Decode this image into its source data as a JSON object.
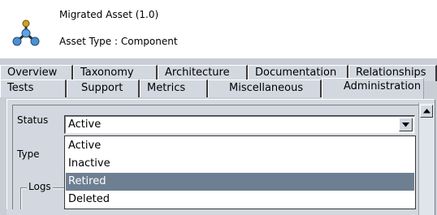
{
  "header": {
    "title": "Migrated Asset (1.0)",
    "asset_type": "Asset Type : Component",
    "icon": "component-molecule-icon"
  },
  "tabs": {
    "back_row": [
      {
        "label": "Overview"
      },
      {
        "label": "Taxonomy"
      },
      {
        "label": "Architecture"
      },
      {
        "label": "Documentation"
      },
      {
        "label": "Relationships"
      }
    ],
    "front_row": [
      {
        "label": "Tests"
      },
      {
        "label": "Support"
      },
      {
        "label": "Metrics"
      },
      {
        "label": "Miscellaneous"
      },
      {
        "label": "Administration",
        "active": true
      }
    ]
  },
  "form": {
    "status_label": "Status",
    "type_label": "Type",
    "logs_label": "Logs",
    "status_value": "Active",
    "status_options": [
      {
        "label": "Active"
      },
      {
        "label": "Inactive"
      },
      {
        "label": "Retired",
        "highlighted": true
      },
      {
        "label": "Deleted"
      }
    ]
  },
  "colors": {
    "highlight": "#6e7f92",
    "panel": "#d3d7df",
    "strip": "#c8cdd6"
  }
}
